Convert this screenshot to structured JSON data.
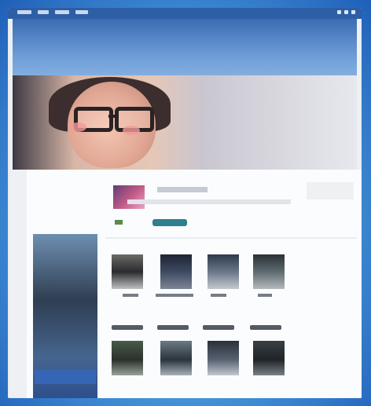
{
  "colors": {
    "topbar": "#2d5fa6",
    "banner": "#3b6cb4",
    "follow_button": "#2e7f8f",
    "background": "#2a6fc0"
  },
  "header": {
    "icons": [
      "menu-icon",
      "home-icon",
      "profile-icon",
      "settings-icon"
    ]
  },
  "profile": {
    "avatar": "avatar",
    "follow_button": "follow-button"
  },
  "gallery": {
    "row1": [
      "thumb-1",
      "thumb-2",
      "thumb-3",
      "thumb-4"
    ],
    "row2": [
      "thumb-5",
      "thumb-6",
      "thumb-7",
      "thumb-8"
    ]
  }
}
